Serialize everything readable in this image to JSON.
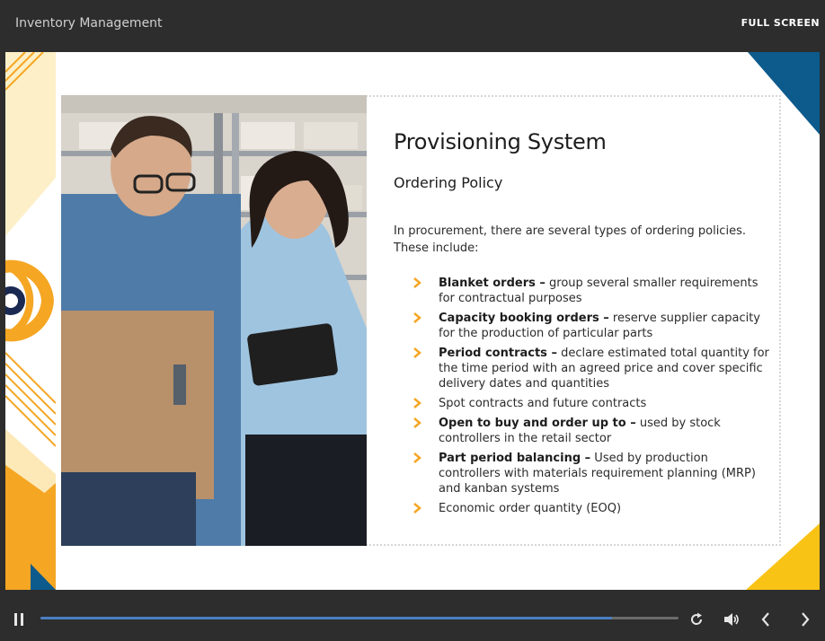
{
  "header": {
    "title": "Inventory Management",
    "fullscreen_label": "FULL SCREEN"
  },
  "slide": {
    "title": "Provisioning System",
    "subtitle": "Ordering Policy",
    "intro": "In procurement, there are several types of ordering policies. These include:",
    "policies": [
      {
        "bold": "Blanket orders –",
        "text": " group several smaller requirements for contractual purposes"
      },
      {
        "bold": "Capacity booking orders –",
        "text": " reserve supplier capacity for the production of particular parts"
      },
      {
        "bold": "Period contracts –",
        "text": " declare estimated total quantity for the time period with an agreed price and cover specific delivery dates and quantities"
      },
      {
        "bold": "",
        "text": "Spot contracts and future contracts"
      },
      {
        "bold": "Open to buy and order up to –",
        "text": " used by stock controllers in the retail sector"
      },
      {
        "bold": "Part period balancing –",
        "text": " Used by production controllers with materials requirement planning (MRP) and kanban systems"
      },
      {
        "bold": "",
        "text": "Economic order quantity (EOQ)"
      }
    ]
  },
  "player": {
    "progress": 0.896,
    "icons": [
      "pause-icon",
      "replay-icon",
      "volume-icon",
      "previous-icon",
      "next-icon"
    ]
  },
  "colors": {
    "accent_yellow": "#f5a623",
    "brand_blue": "#0d5a8c",
    "corner_yellow": "#f9c316",
    "progress_blue": "#4a7fc1"
  }
}
